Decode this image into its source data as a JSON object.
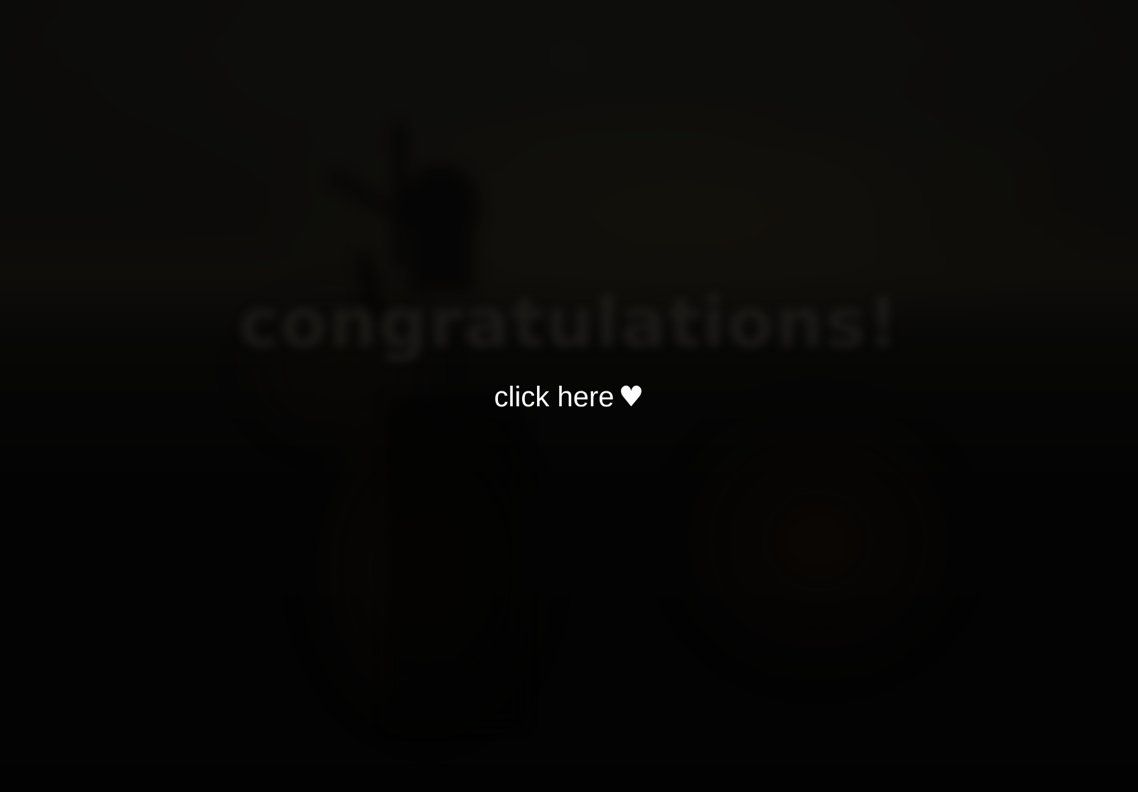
{
  "intro": {
    "label": "click here",
    "heart_glyph": "♥",
    "heart_icon": "heart-icon",
    "text_color": "#ffffff"
  },
  "background": {
    "heading_text": "congratulations!",
    "scene": "blurred windmill silhouette at dusk",
    "tint": "#000000"
  }
}
